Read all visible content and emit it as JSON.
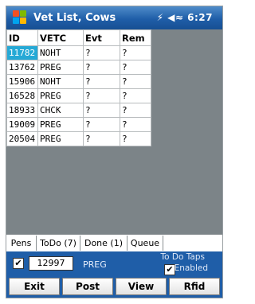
{
  "title_bar": {
    "title": "Vet List, Cows",
    "time": "6:27",
    "status_icons": "⚡ ◀≈"
  },
  "grid": {
    "headers": [
      "ID",
      "VETC",
      "Evt",
      "Rem"
    ],
    "rows": [
      [
        "11782",
        "NOHT",
        "?",
        "?"
      ],
      [
        "13762",
        "PREG",
        "?",
        "?"
      ],
      [
        "15906",
        "NOHT",
        "?",
        "?"
      ],
      [
        "16528",
        "PREG",
        "?",
        "?"
      ],
      [
        "18933",
        "CHCK",
        "?",
        "?"
      ],
      [
        "19009",
        "PREG",
        "?",
        "?"
      ],
      [
        "20504",
        "PREG",
        "?",
        "?"
      ]
    ],
    "selected_cell": "11782"
  },
  "tabs": [
    "Pens",
    "ToDo (7)",
    "Done (1)",
    "Queue"
  ],
  "active_tab": "ToDo (7)",
  "controls": {
    "id_value": "12997",
    "vetc_value": "PREG",
    "todo_label": "To Do Taps",
    "enabled_label": "Enabled",
    "checked": "✔"
  },
  "buttons": [
    "Exit",
    "Post",
    "View",
    "Rfid"
  ],
  "colors": {
    "titlebar": "#1f5ea8",
    "selection": "#25a9d6",
    "grid_bg": "#7c8488"
  }
}
